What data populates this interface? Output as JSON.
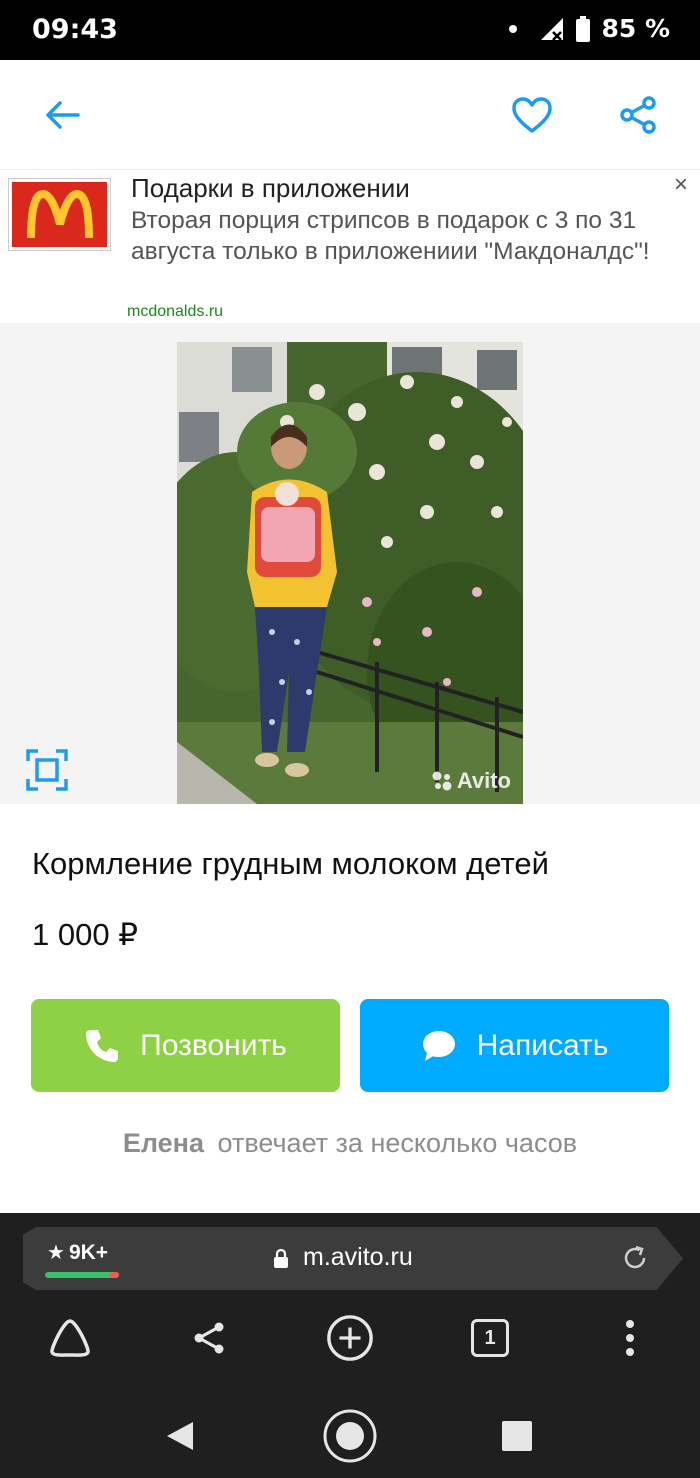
{
  "status_bar": {
    "time": "09:43",
    "battery": "85 %"
  },
  "ad": {
    "title": "Подарки в приложении",
    "text": "Вторая порция стрипсов в подарок с 3 по 31 августа только в приложениии \"Макдоналдс\"!",
    "domain": "mcdonalds.ru",
    "close_label": "×"
  },
  "photo": {
    "watermark": "Avito"
  },
  "listing": {
    "title": "Кормление грудным молоком детей",
    "price": "1 000 ₽"
  },
  "actions": {
    "call_label": "Позвонить",
    "write_label": "Написать"
  },
  "seller": {
    "name": "Елена",
    "response": "отвечает за несколько часов"
  },
  "browser": {
    "rating": "9K+",
    "url": "m.avito.ru",
    "tabs_count": "1"
  },
  "colors": {
    "call": "#8fd144",
    "write": "#00aaff",
    "accent": "#00aaff",
    "mcd_red": "#da291c",
    "mcd_yellow": "#ffc72c"
  }
}
